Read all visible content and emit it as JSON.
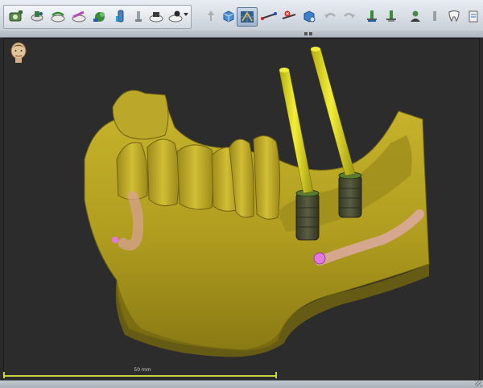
{
  "viewport": {
    "scale_label": "50 mm"
  },
  "icons": {
    "toolbar_left": [
      "new-scan-icon",
      "segment-icon",
      "panoramic-curve-icon",
      "nerve-canal-icon",
      "surface-model-icon",
      "implant-library-icon",
      "disabled-tool-icon",
      "prosthetic-icon",
      "guide-design-icon"
    ],
    "toolbar_right": [
      "move-tool-icon",
      "view-3d-icon",
      "grid-view-icon",
      "measure-distance-icon",
      "clear-measure-icon",
      "render-icon",
      "undo-icon",
      "redo-icon",
      "add-implant-icon",
      "remove-implant-icon",
      "user-tool-icon",
      "disabled-tool-icon-2",
      "tooth-icon",
      "export-icon"
    ]
  },
  "colors": {
    "bone": "#b5a422",
    "implant_post": "#e8e020",
    "implant_body": "#4a4d33",
    "nerve": "#d9a89a",
    "nerve_marker": "#e07adf",
    "background": "#2c2c2c"
  }
}
